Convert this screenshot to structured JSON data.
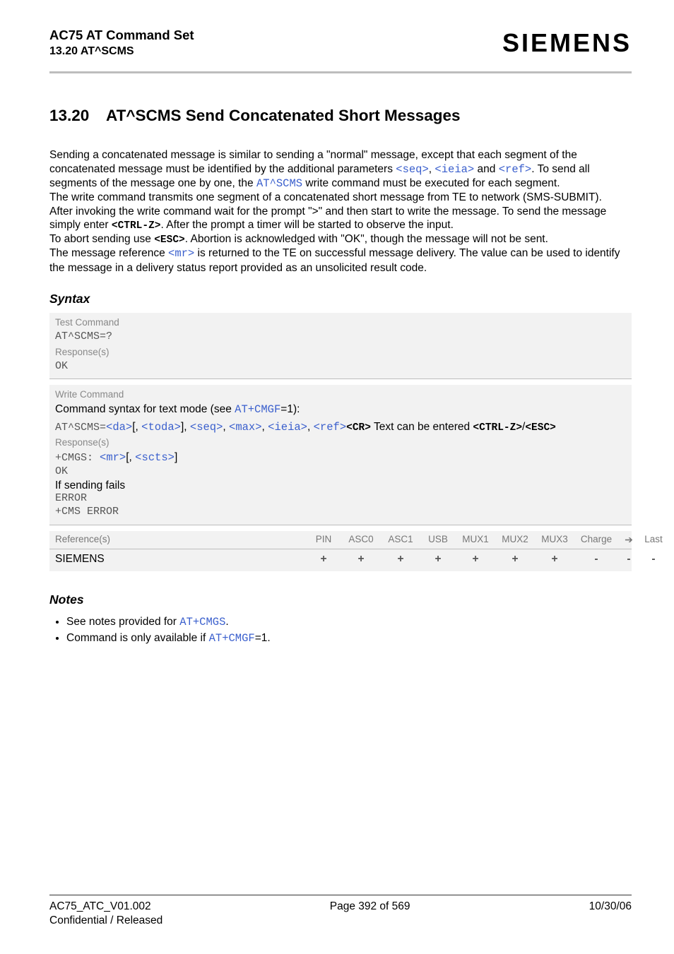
{
  "header": {
    "doc_title": "AC75 AT Command Set",
    "doc_section": "13.20 AT^SCMS",
    "brand": "SIEMENS"
  },
  "heading": {
    "number": "13.20",
    "title": "AT^SCMS   Send Concatenated Short Messages"
  },
  "intro": {
    "p1_a": "Sending a concatenated message is similar to sending a \"normal\" message, except that each segment of the concatenated message must be identified by the additional parameters ",
    "p1_seq": "<seq>",
    "p1_b": ", ",
    "p1_ieia": "<ieia>",
    "p1_c": " and ",
    "p1_ref": "<ref>",
    "p1_d": ". To send all segments of the message one by one, the ",
    "p1_cmd": "AT^SCMS",
    "p1_e": " write command must be executed for each segment.",
    "p2": "The write command transmits one segment of a concatenated short message from TE to network (SMS-SUBMIT).",
    "p3_a": "After invoking the write command wait for the prompt \">\" and then start to write the message. To send the message simply enter ",
    "p3_ctrlz": "<CTRL-Z>",
    "p3_b": ". After the prompt a timer will be started to observe the input.",
    "p4_a": "To abort sending use ",
    "p4_esc": "<ESC>",
    "p4_b": ". Abortion is acknowledged with \"OK\", though the message will not be sent.",
    "p5_a": "The message reference ",
    "p5_mr": "<mr>",
    "p5_b": " is returned to the TE on successful message delivery. The value can be used to identify the message in a delivery status report provided as an unsolicited result code."
  },
  "syntax": {
    "title": "Syntax",
    "test": {
      "label": "Test Command",
      "cmd": "AT^SCMS=?",
      "resp_label": "Response(s)",
      "resp": "OK"
    },
    "write": {
      "label": "Write Command",
      "line1_a": "Command syntax for text mode (see ",
      "line1_cmd": "AT+CMGF",
      "line1_b": "=1):",
      "line2_pre": "AT^SCMS=",
      "da": "<da>",
      "lbrack1": "[, ",
      "toda": "<toda>",
      "rbrack1": "], ",
      "seq": "<seq>",
      "c1": ", ",
      "max": "<max>",
      "c2": ", ",
      "ieia": "<ieia>",
      "c3": ", ",
      "ref": "<ref>",
      "cr": "<CR>",
      "txt_entered": " Text can be entered ",
      "ctrlz": "<CTRL-Z>",
      "slash": "/",
      "esc": "<ESC>",
      "resp_label": "Response(s)",
      "r_cmgs": "+CMGS: ",
      "r_mr": "<mr>",
      "r_lb": "[, ",
      "r_scts": "<scts>",
      "r_rb": "]",
      "r_ok": "OK",
      "r_fail": "If sending fails",
      "r_error": "ERROR",
      "r_cms": "+CMS ERROR"
    },
    "refrow": {
      "label": "Reference(s)",
      "cols": [
        "PIN",
        "ASC0",
        "ASC1",
        "USB",
        "MUX1",
        "MUX2",
        "MUX3",
        "Charge",
        "➔",
        "Last"
      ],
      "name": "SIEMENS",
      "vals": [
        "+",
        "+",
        "+",
        "+",
        "+",
        "+",
        "+",
        "-",
        "-",
        "-"
      ]
    }
  },
  "notes": {
    "title": "Notes",
    "n1_a": "See notes provided for ",
    "n1_cmd": "AT+CMGS",
    "n1_b": ".",
    "n2_a": "Command is only available if ",
    "n2_cmd": "AT+CMGF",
    "n2_b": "=1."
  },
  "footer": {
    "left": "AC75_ATC_V01.002",
    "center": "Page 392 of 569",
    "right": "10/30/06",
    "confidential": "Confidential / Released"
  }
}
